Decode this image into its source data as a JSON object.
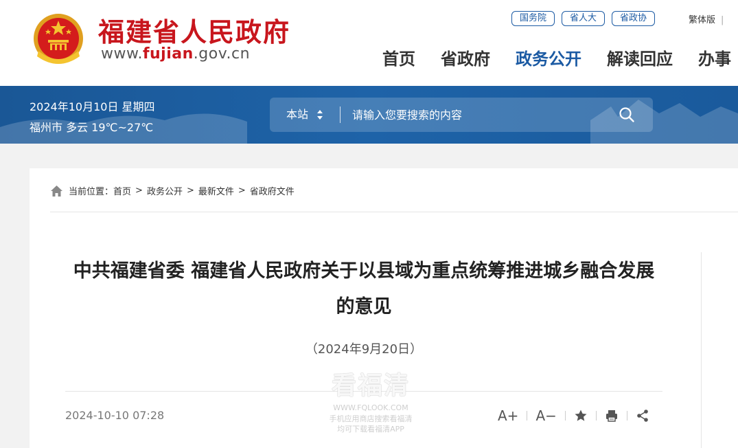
{
  "header": {
    "site_title": "福建省人民政府",
    "url_prefix": "www.",
    "url_domain": "fujian",
    "url_suffix": ".gov.cn",
    "emblem_icon": "national-emblem-icon",
    "quick_links": [
      {
        "label": "国务院"
      },
      {
        "label": "省人大"
      },
      {
        "label": "省政协"
      }
    ],
    "language": "繁体版",
    "language_sep": "|",
    "nav": [
      {
        "label": "首页",
        "active": false
      },
      {
        "label": "省政府",
        "active": false
      },
      {
        "label": "政务公开",
        "active": true
      },
      {
        "label": "解读回应",
        "active": false
      },
      {
        "label": "办事",
        "active": false
      }
    ]
  },
  "banner": {
    "date": "2024年10月10日 星期四",
    "weather": "福州市 多云 19℃~27℃",
    "search_scope": "本站",
    "search_placeholder": "请输入您要搜索的内容",
    "search_icon": "search-icon"
  },
  "breadcrumb": {
    "prefix": "当前位置：",
    "items": [
      "首页",
      "政务公开",
      "最新文件",
      "省政府文件"
    ],
    "separator": ">"
  },
  "document": {
    "title": "中共福建省委 福建省人民政府关于以县域为重点统筹推进城乡融合发展的意见",
    "date": "（2024年9月20日）",
    "published": "2024-10-10 07:28"
  },
  "tools": {
    "font_larger": "A+",
    "font_smaller": "A−",
    "favorite_icon": "star-icon",
    "print_icon": "printer-icon",
    "share_icon": "share-icon"
  },
  "watermark": {
    "brand": "看福清",
    "url": "WWW.FQLOOK.COM",
    "line1": "手机应用商店搜索看福清",
    "line2": "均可下载看福清APP"
  },
  "colors": {
    "brand_red": "#c8161d",
    "brand_blue": "#1b5aa3",
    "banner_blue": "#1e63a8"
  }
}
